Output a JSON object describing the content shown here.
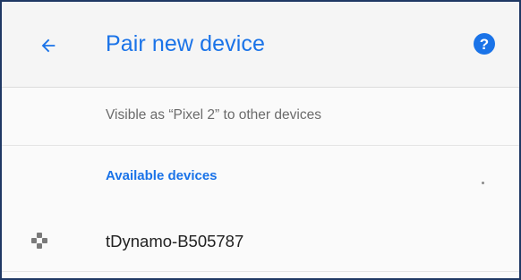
{
  "colors": {
    "accent": "#1a73e8",
    "frame_border": "#1f3864"
  },
  "header": {
    "back_icon": "arrow-back-icon",
    "title": "Pair new device",
    "help_icon": "help-icon"
  },
  "visibility": {
    "text": "Visible as “Pixel 2” to other devices"
  },
  "available_section": {
    "title": "Available devices",
    "scanning_indicator": "progress-dot"
  },
  "devices": [
    {
      "name": "tDynamo-B505787",
      "icon": "gamepad-icon"
    }
  ]
}
